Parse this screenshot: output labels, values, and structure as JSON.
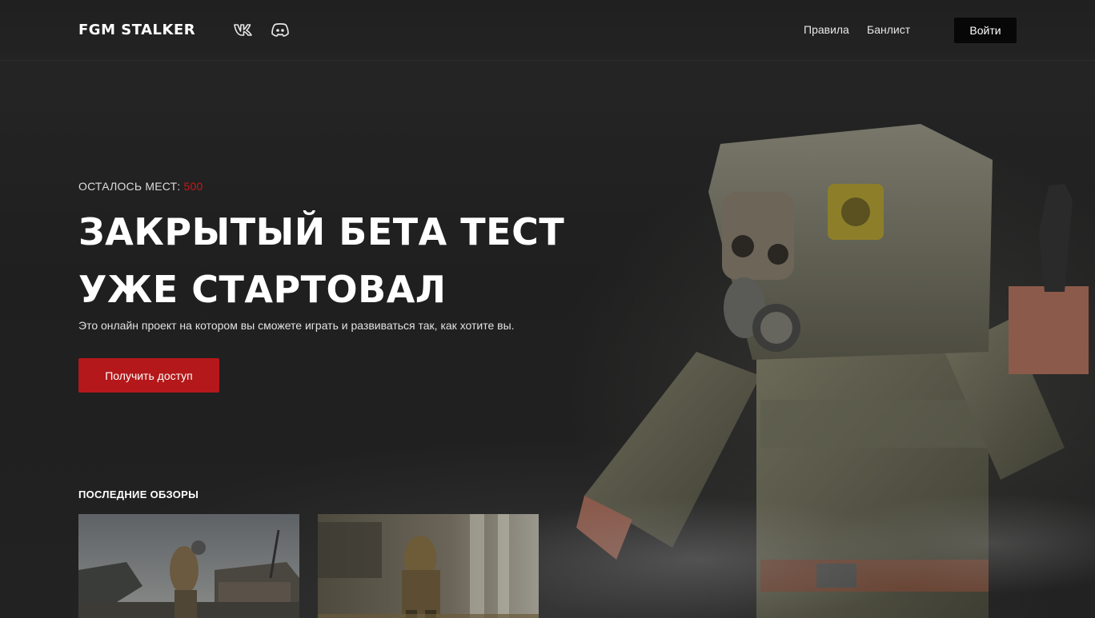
{
  "header": {
    "logo": "FGM STALKER",
    "social": [
      {
        "icon": "vk-icon"
      },
      {
        "icon": "discord-icon"
      }
    ],
    "nav": [
      {
        "label": "Правила"
      },
      {
        "label": "Банлист"
      }
    ],
    "login_label": "Войти"
  },
  "hero": {
    "slots_label": "ОСТАЛОСЬ МЕСТ:",
    "slots_count": "500",
    "title_line1": "ЗАКРЫТЫЙ БЕТА ТЕСТ",
    "title_line2": "УЖЕ СТАРТОВАЛ",
    "subtitle": "Это онлайн проект на котором вы сможете играть и развиваться так, как хотите вы.",
    "cta_label": "Получить доступ"
  },
  "reviews": {
    "title": "ПОСЛЕДНИЕ ОБЗОРЫ"
  },
  "colors": {
    "accent": "#b4181a",
    "slots_count": "#c31b1b",
    "background": "#1f1f1f",
    "login_bg": "#070707"
  }
}
